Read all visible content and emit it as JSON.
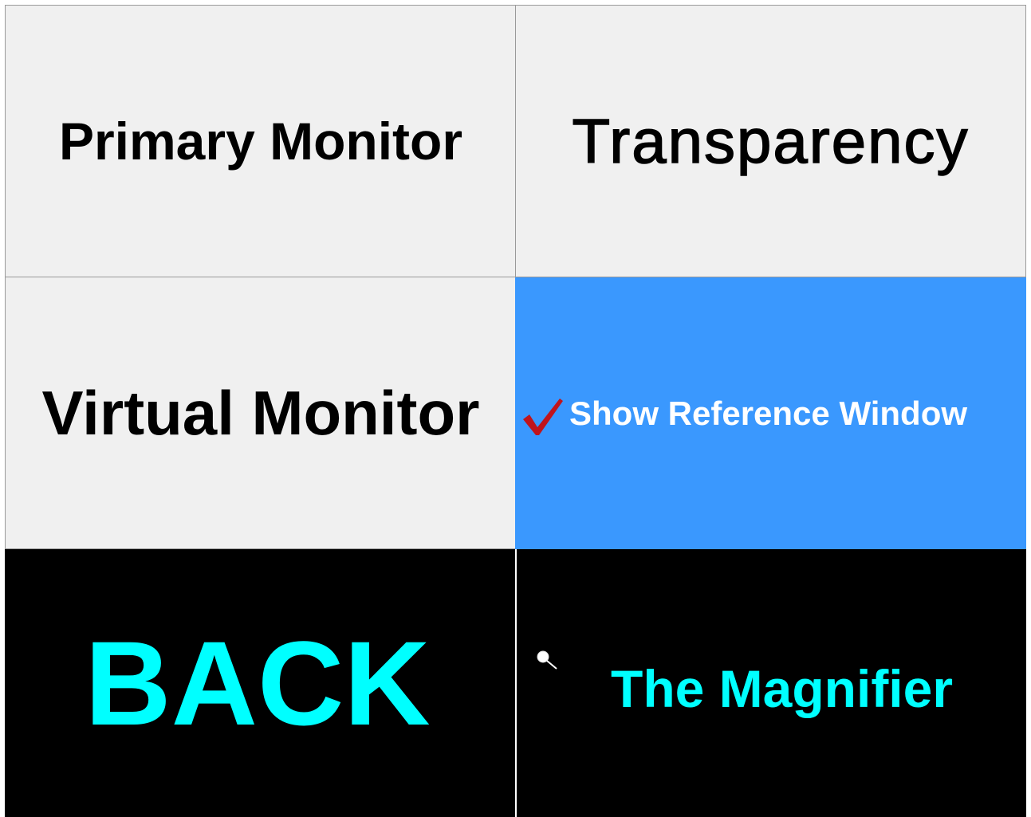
{
  "menu": {
    "primary_monitor": "Primary Monitor",
    "transparency": "Transparency",
    "virtual_monitor": "Virtual Monitor",
    "show_reference_window": "Show Reference Window",
    "show_reference_window_checked": true,
    "back": "BACK",
    "the_magnifier": "The Magnifier"
  },
  "icons": {
    "check": "check-icon",
    "magnifier": "magnifier-icon"
  },
  "colors": {
    "tile_background": "#f0f0f0",
    "tile_border": "#9a9a9a",
    "selected_background": "#3a98fe",
    "selected_text": "#ffffff",
    "checkmark": "#c0141c",
    "dark_background": "#000000",
    "dark_text": "#00ffff"
  }
}
